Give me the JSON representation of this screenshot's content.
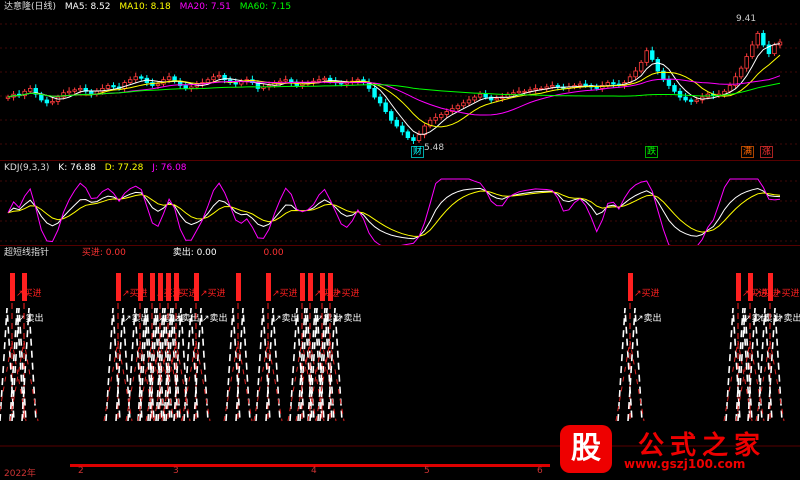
{
  "main_header": {
    "title": "达意隆(日线)",
    "ma5": "MA5: 8.52",
    "ma10": "MA10: 8.18",
    "ma20": "MA20: 7.51",
    "ma60": "MA60: 7.15"
  },
  "kdj_header": {
    "title": "KDJ(9,3,3)",
    "k": "K: 76.88",
    "d": "D: 77.28",
    "j": "J: 76.08"
  },
  "ind_header": {
    "title": "超短线指针",
    "buy": "买进: 0.00",
    "sell": "卖出: 0.00",
    "extra": "0.00"
  },
  "colors": {
    "up": "#ff3c3c",
    "down": "#00ffff",
    "ma5": "#ffffff",
    "ma10": "#ffff00",
    "ma20": "#ff00ff",
    "ma60": "#00ff00",
    "grid": "#801010",
    "buy": "#ff2020",
    "sell": "#ffffff"
  },
  "markers": {
    "high": "9.41",
    "low": "5.48",
    "badge_fall": "跌",
    "badge_fin": "财",
    "badge_rise": "涨",
    "badge_rise2": "满"
  },
  "signal_labels": {
    "buy": "买进",
    "sell": "卖出",
    "arrow": "↗"
  },
  "dates": [
    "2022年",
    "2",
    "3",
    "4",
    "5",
    "6"
  ],
  "watermark": {
    "gu": "股",
    "name": "公式之家",
    "url": "www.gszj100.com"
  },
  "chart_data": {
    "type": "line",
    "price_range": [
      5.0,
      9.8
    ],
    "low": 5.48,
    "high": 9.41,
    "ma_last": {
      "MA5": 8.52,
      "MA10": 8.18,
      "MA20": 7.51,
      "MA60": 7.15
    },
    "kdj_last": {
      "K": 76.88,
      "D": 77.28,
      "J": 76.08
    },
    "close_series": [
      7.0,
      7.1,
      7.05,
      7.2,
      7.3,
      7.1,
      6.9,
      6.8,
      6.85,
      7.0,
      7.15,
      7.2,
      7.25,
      7.3,
      7.2,
      7.1,
      7.2,
      7.3,
      7.4,
      7.35,
      7.3,
      7.5,
      7.6,
      7.7,
      7.65,
      7.5,
      7.4,
      7.45,
      7.6,
      7.7,
      7.55,
      7.4,
      7.3,
      7.35,
      7.45,
      7.5,
      7.6,
      7.7,
      7.75,
      7.6,
      7.5,
      7.45,
      7.55,
      7.6,
      7.5,
      7.3,
      7.35,
      7.4,
      7.5,
      7.55,
      7.6,
      7.5,
      7.4,
      7.45,
      7.5,
      7.55,
      7.6,
      7.65,
      7.55,
      7.5,
      7.45,
      7.5,
      7.55,
      7.6,
      7.5,
      7.3,
      7.0,
      6.8,
      6.5,
      6.2,
      6.0,
      5.8,
      5.6,
      5.5,
      5.7,
      6.0,
      6.2,
      6.3,
      6.4,
      6.5,
      6.6,
      6.7,
      6.8,
      6.9,
      7.0,
      7.1,
      7.0,
      6.9,
      6.95,
      7.0,
      7.1,
      7.15,
      7.2,
      7.2,
      7.25,
      7.3,
      7.3,
      7.35,
      7.4,
      7.35,
      7.3,
      7.35,
      7.4,
      7.45,
      7.4,
      7.35,
      7.3,
      7.4,
      7.5,
      7.45,
      7.4,
      7.5,
      7.7,
      7.9,
      8.2,
      8.6,
      8.3,
      7.9,
      7.6,
      7.4,
      7.2,
      7.0,
      6.9,
      6.85,
      6.9,
      7.0,
      7.1,
      7.05,
      7.1,
      7.2,
      7.4,
      7.7,
      8.0,
      8.4,
      8.8,
      9.2,
      8.8,
      8.5,
      8.8,
      8.9
    ]
  }
}
